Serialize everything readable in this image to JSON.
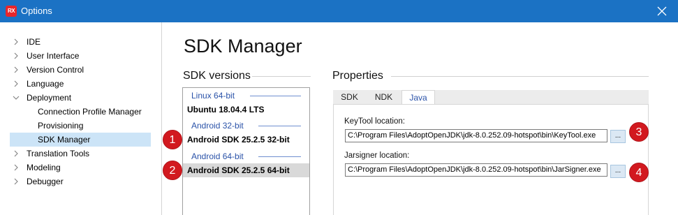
{
  "window": {
    "app_icon_text": "RX",
    "title": "Options",
    "accent_color": "#1b72c4"
  },
  "nav": {
    "items": [
      {
        "label": "IDE",
        "expanded": false
      },
      {
        "label": "User Interface",
        "expanded": false
      },
      {
        "label": "Version Control",
        "expanded": false
      },
      {
        "label": "Language",
        "expanded": false
      },
      {
        "label": "Deployment",
        "expanded": true
      },
      {
        "label": "Connection Profile Manager",
        "child": true
      },
      {
        "label": "Provisioning",
        "child": true
      },
      {
        "label": "SDK Manager",
        "child": true,
        "selected": true
      },
      {
        "label": "Translation Tools",
        "expanded": false
      },
      {
        "label": "Modeling",
        "expanded": false
      },
      {
        "label": "Debugger",
        "expanded": false
      }
    ]
  },
  "main": {
    "page_title": "SDK Manager",
    "sdk_versions_heading": "SDK versions",
    "properties_heading": "Properties",
    "sdk_list": {
      "groups": [
        {
          "label": "Linux 64-bit"
        },
        {
          "label": "Android 32-bit"
        },
        {
          "label": "Android 64-bit"
        }
      ],
      "items": [
        {
          "label": "Ubuntu 18.04.4 LTS"
        },
        {
          "label": "Android SDK 25.2.5 32-bit"
        },
        {
          "label": "Android SDK 25.2.5 64-bit",
          "selected": true
        }
      ]
    },
    "tabs": [
      {
        "label": "SDK"
      },
      {
        "label": "NDK"
      },
      {
        "label": "Java",
        "active": true
      }
    ],
    "java": {
      "keytool_label": "KeyTool location:",
      "keytool_value": "C:\\Program Files\\AdoptOpenJDK\\jdk-8.0.252.09-hotspot\\bin\\KeyTool.exe",
      "jarsigner_label": "Jarsigner location:",
      "jarsigner_value": "C:\\Program Files\\AdoptOpenJDK\\jdk-8.0.252.09-hotspot\\bin\\JarSigner.exe",
      "browse_label": "..."
    }
  },
  "callouts": [
    "1",
    "2",
    "3",
    "4"
  ],
  "callout_color": "#d2191f"
}
